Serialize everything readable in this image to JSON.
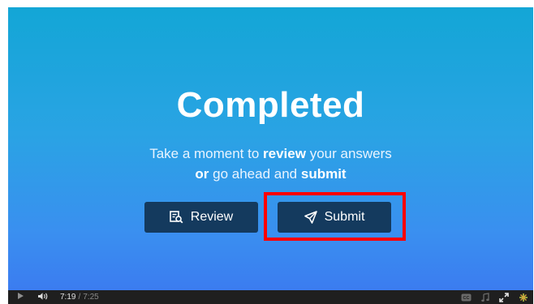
{
  "slide": {
    "title": "Completed",
    "subtitle_line1_pre": "Take a moment to ",
    "subtitle_line1_bold": "review",
    "subtitle_line1_post": " your answers",
    "subtitle_line2_bold_a": "or",
    "subtitle_line2_mid": " go ahead and ",
    "subtitle_line2_bold_b": "submit"
  },
  "buttons": {
    "review_label": "Review",
    "submit_label": "Submit"
  },
  "player": {
    "current_time": "7:19",
    "separator": "/",
    "duration": "7:25"
  },
  "colors": {
    "button_bg": "#143a5e",
    "highlight": "#ff0000",
    "bar_bg": "#1f1f1f",
    "logo_accent": "#c9d84a"
  },
  "icons": {
    "review": "review-search-icon",
    "submit": "paper-plane-icon",
    "play": "play-icon",
    "volume": "volume-icon",
    "cc": "closed-captions-icon",
    "music": "music-note-icon",
    "fullscreen": "fullscreen-icon",
    "logo": "player-logo-icon"
  }
}
